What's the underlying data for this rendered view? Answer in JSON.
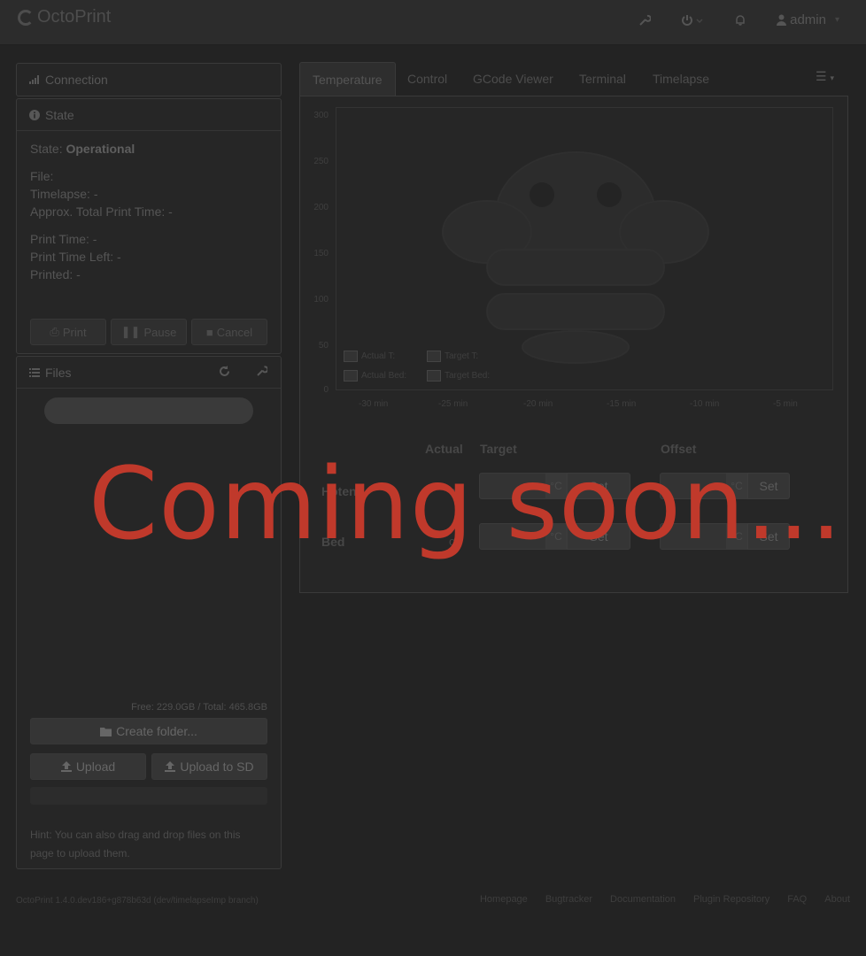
{
  "navbar": {
    "brand": "OctoPrint",
    "user": "admin"
  },
  "connection": {
    "title": "Connection"
  },
  "state": {
    "title": "State",
    "state_label": "State:",
    "state_value": "Operational",
    "file": "File:",
    "timelapse": "Timelapse: -",
    "approx": "Approx. Total Print Time: -",
    "print_time": "Print Time: -",
    "print_time_left": "Print Time Left: -",
    "printed": "Printed: -",
    "print_btn": "Print",
    "pause_btn": "Pause",
    "cancel_btn": "Cancel"
  },
  "files": {
    "title": "Files",
    "free": "Free: 229.0GB / Total: 465.8GB",
    "create_folder": "Create folder...",
    "upload": "Upload",
    "upload_sd": "Upload to SD",
    "hint": "Hint: You can also drag and drop files on this page to upload them."
  },
  "tabs": [
    "Temperature",
    "Control",
    "GCode Viewer",
    "Terminal",
    "Timelapse"
  ],
  "temperature": {
    "y_ticks": [
      "300",
      "250",
      "200",
      "150",
      "100",
      "50",
      "0"
    ],
    "x_ticks": [
      "-30 min",
      "-25 min",
      "-20 min",
      "-15 min",
      "-10 min",
      "-5 min"
    ],
    "legend": [
      "Actual T:",
      "Target T:",
      "Actual Bed:",
      "Target Bed:"
    ],
    "headers": {
      "actual": "Actual",
      "target": "Target",
      "offset": "Offset"
    },
    "rows": [
      {
        "label": "Hotend",
        "actual": "off",
        "unit": "°C",
        "set": "Set"
      },
      {
        "label": "Bed",
        "actual": "off",
        "unit": "°C",
        "set": "Set"
      }
    ]
  },
  "footer": {
    "version": "OctoPrint 1.4.0.dev186+g878b63d (dev/timelapseImp branch)",
    "links": [
      "Homepage",
      "Bugtracker",
      "Documentation",
      "Plugin Repository",
      "FAQ",
      "About"
    ]
  },
  "overlay": "Coming soon..."
}
